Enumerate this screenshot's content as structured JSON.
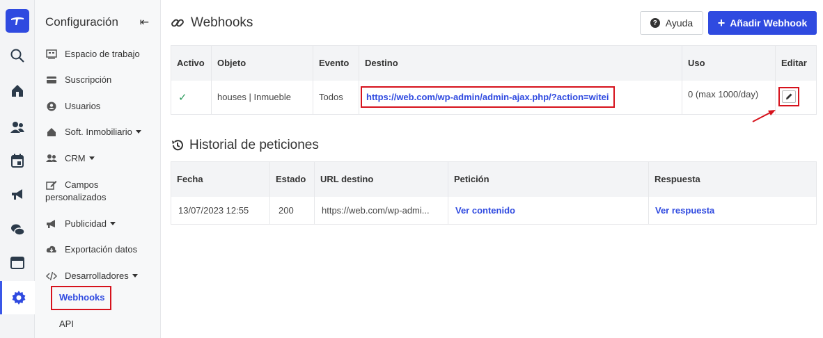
{
  "sidebar": {
    "title": "Configuración",
    "items": {
      "workspace": "Espacio de trabajo",
      "subscription": "Suscripción",
      "users": "Usuarios",
      "real_estate": "Soft. Inmobiliario",
      "crm": "CRM",
      "custom_fields_1": "Campos",
      "custom_fields_2": "personalizados",
      "advertising": "Publicidad",
      "export": "Exportación datos",
      "developers": "Desarrolladores",
      "webhooks": "Webhooks",
      "api": "API"
    }
  },
  "header": {
    "title": "Webhooks",
    "help_label": "Ayuda",
    "add_label": "Añadir Webhook"
  },
  "webhooks_table": {
    "headers": [
      "Activo",
      "Objeto",
      "Evento",
      "Destino",
      "Uso",
      "Editar"
    ],
    "row": {
      "active": "✓",
      "object": "houses | Inmueble",
      "event": "Todos",
      "destination": "https://web.com/wp-admin/admin-ajax.php/?action=witei",
      "usage": "0 (max 1000/day)"
    }
  },
  "history": {
    "title": "Historial de peticiones",
    "headers": [
      "Fecha",
      "Estado",
      "URL destino",
      "Petición",
      "Respuesta"
    ],
    "row": {
      "date": "13/07/2023 12:55",
      "status": "200",
      "url": "https://web.com/wp-admi...",
      "request_link": "Ver contenido",
      "response_link": "Ver respuesta"
    }
  },
  "colors": {
    "accent": "#2f4ae0",
    "highlight": "#d6121c",
    "success": "#2e9c5e"
  }
}
